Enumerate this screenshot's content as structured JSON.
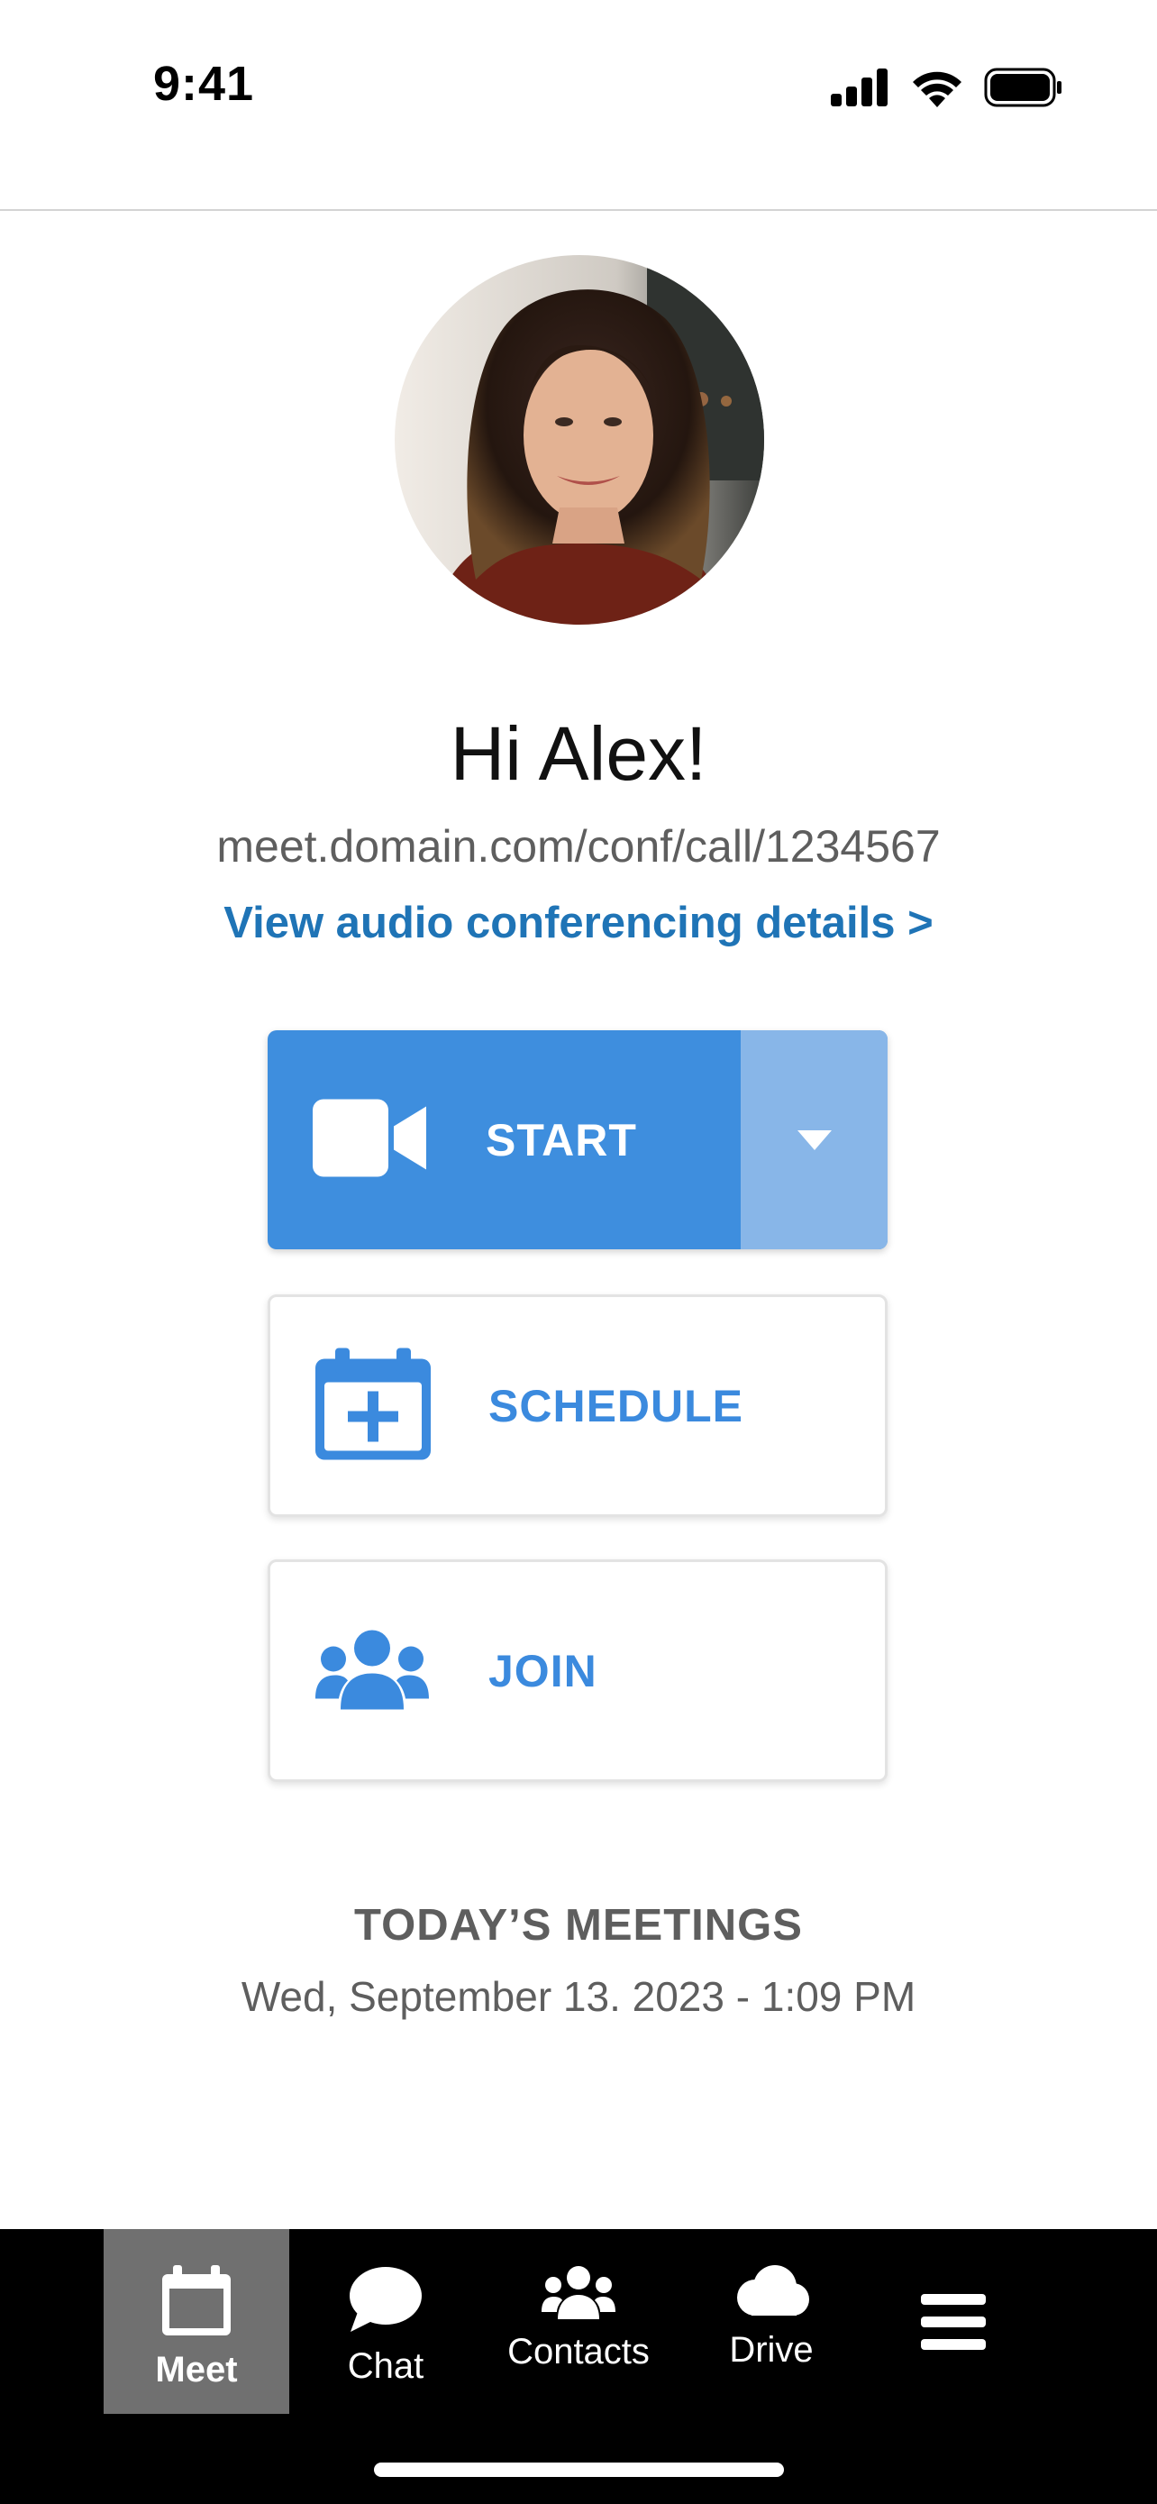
{
  "status_bar": {
    "time": "9:41"
  },
  "profile": {
    "greeting": "Hi Alex!",
    "meeting_url": "meet.domain.com/conf/call/1234567",
    "audio_link": "View audio conferencing details >"
  },
  "actions": {
    "start_label": "START",
    "schedule_label": "SCHEDULE",
    "join_label": "JOIN"
  },
  "meetings": {
    "heading": "TODAY’S MEETINGS",
    "date": "Wed, September 13. 2023 - 1:09 PM"
  },
  "tab_bar": {
    "items": [
      {
        "label": "Meet",
        "icon": "calendar-icon",
        "active": true
      },
      {
        "label": "Chat",
        "icon": "chat-bubble-icon"
      },
      {
        "label": "Contacts",
        "icon": "users-icon"
      },
      {
        "label": "Drive",
        "icon": "cloud-icon"
      },
      {
        "label": "",
        "icon": "menu-icon"
      }
    ]
  },
  "colors": {
    "primary": "#3e8ede",
    "primary_light": "#88b6e8",
    "link": "#1f74b6",
    "active_tab": "#707070"
  }
}
